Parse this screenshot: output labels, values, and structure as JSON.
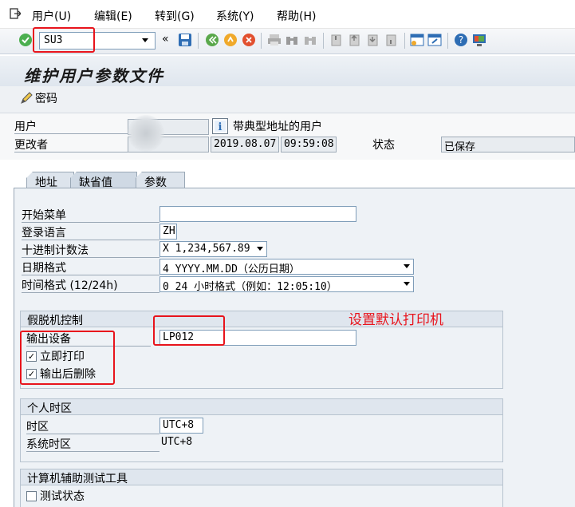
{
  "menu": [
    "用户(U)",
    "编辑(E)",
    "转到(G)",
    "系统(Y)",
    "帮助(H)"
  ],
  "toolbar": {
    "command": "SU3"
  },
  "title": "维护用户参数文件",
  "app_toolbar": {
    "password_label": "密码"
  },
  "header": {
    "user_label": "用户",
    "user_value": "",
    "user_type_text": "带典型地址的用户",
    "changed_by_label": "更改者",
    "changed_by_value": "",
    "date": "2019.08.07",
    "time": "09:59:08",
    "status_label": "状态",
    "status_value": "已保存"
  },
  "tabs": [
    "地址",
    "缺省值",
    "参数"
  ],
  "defaults": {
    "start_menu_label": "开始菜单",
    "start_menu_value": "",
    "logon_lang_label": "登录语言",
    "logon_lang_value": "ZH",
    "decimal_label": "十进制计数法",
    "decimal_value": "X 1,234,567.89",
    "date_format_label": "日期格式",
    "date_format_value": "4 YYYY.MM.DD（公历日期）",
    "time_format_label": "时间格式 (12/24h)",
    "time_format_value": "0 24 小时格式（例如：12:05:10）"
  },
  "spool": {
    "title": "假脱机控制",
    "output_device_label": "输出设备",
    "output_device_value": "LP012",
    "print_now_label": "立即打印",
    "print_now_checked": true,
    "delete_after_label": "输出后删除",
    "delete_after_checked": true
  },
  "annotation": "设置默认打印机",
  "timezone": {
    "title": "个人时区",
    "tz_label": "时区",
    "tz_value": "UTC+8",
    "sys_tz_label": "系统时区",
    "sys_tz_value": "UTC+8"
  },
  "catt": {
    "title": "计算机辅助测试工具",
    "test_status_label": "测试状态",
    "test_status_checked": false
  },
  "colors": {
    "accent_red": "#e8141c",
    "panel_bg": "#eef2f6"
  }
}
